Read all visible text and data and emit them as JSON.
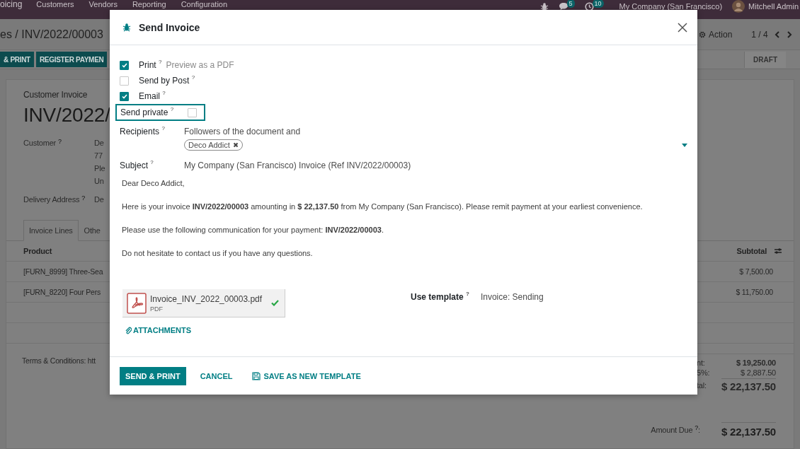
{
  "navbar": {
    "app": "oicing",
    "menu": [
      "Customers",
      "Vendors",
      "Reporting",
      "Configuration"
    ],
    "chat_count": "5",
    "activity_count": "10",
    "company": "My Company (San Francisco)",
    "user": "Mitchell Admin"
  },
  "breadcrumb": "es / INV/2022/00003",
  "control_panel": {
    "action": "Action",
    "pager": "1 / 4"
  },
  "status_buttons": [
    "& PRINT",
    "REGISTER PAYMEN"
  ],
  "status": "DRAFT",
  "form": {
    "title": "Customer Invoice",
    "number": "INV/2022/",
    "fields": [
      {
        "label": "Customer $^{?}$",
        "lines": [
          "De",
          "77",
          "Ple",
          "Un"
        ]
      },
      {
        "label": "Delivery Address $^{?}$",
        "lines": [
          "De"
        ]
      }
    ],
    "tabs": [
      {
        "label": "Invoice Lines",
        "selected": true
      },
      {
        "label": "Othe",
        "selected": false
      }
    ],
    "columns": [
      "Product",
      "Subtotal"
    ],
    "rows": [
      {
        "product": "[FURN_8999] Three-Sea",
        "subtotal": "$ 7,500.00"
      },
      {
        "product": "[FURN_8220] Four Pers",
        "subtotal": "$ 11,750.00"
      }
    ],
    "terms": "Terms & Conditions: htt",
    "totals": [
      {
        "label": "nt:",
        "value": "$ 19,250.00",
        "kind": "bold"
      },
      {
        "label": "5%:",
        "value": "$ 2,887.50",
        "kind": "plain"
      },
      {
        "label": "tal:",
        "value": "$ 22,137.50",
        "kind": "grand"
      }
    ],
    "amount_due": {
      "label": "Amount Due $^{?}$:",
      "value": "$ 22,137.50"
    }
  },
  "dialog": {
    "title": "Send Invoice",
    "options": [
      {
        "label": "Print $^{?}$",
        "hint": "Preview as a PDF",
        "checked": true
      },
      {
        "label": "Send by Post $^{?}$",
        "checked": false
      },
      {
        "label": "Email $^{?}$",
        "checked": true
      }
    ],
    "send_private": {
      "label": "Send private $^{?}$",
      "checked": false,
      "focused": true
    },
    "recipients": {
      "label": "Recipients $^{?}$",
      "text": "Followers of the document and",
      "tags": [
        "Deco Addict"
      ]
    },
    "subject": {
      "label": "Subject $^{?}$",
      "value": "My Company (San Francisco) Invoice (Ref INV/2022/00003)"
    },
    "body": [
      "Dear Deco Addict,",
      "Here is your invoice **INV/2022/00003** amounting in **$ 22,137.50** from My Company (San Francisco). Please remit payment at your earliest convenience.",
      "Please use the following communication for your payment: **INV/2022/00003**.",
      "Do not hesitate to contact us if you have any questions."
    ],
    "attachment": {
      "name": "Invoice_INV_2022_00003.pdf",
      "type": "PDF",
      "uploaded": true
    },
    "template": {
      "label": "Use template $^{?}$",
      "value": "Invoice: Sending"
    },
    "attachments_link": "ATTACHMENTS",
    "buttons": [
      {
        "label": "SEND & PRINT",
        "kind": "primary"
      },
      {
        "label": "CANCEL",
        "kind": "link"
      },
      {
        "label": "SAVE AS NEW TEMPLATE",
        "kind": "save"
      }
    ]
  }
}
